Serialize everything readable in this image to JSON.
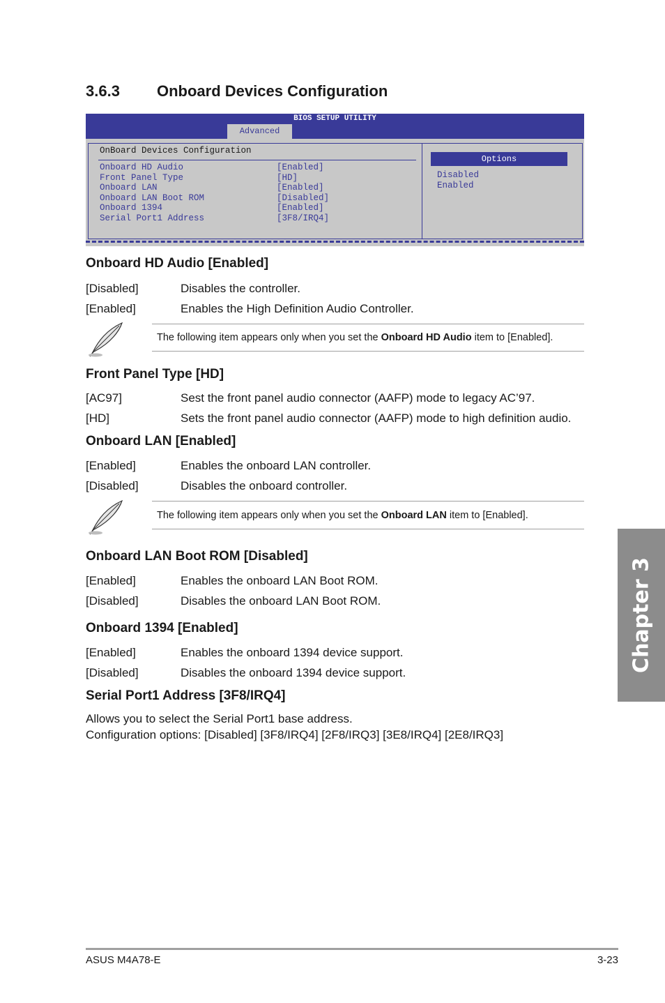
{
  "section": {
    "number": "3.6.3",
    "title": "Onboard Devices Configuration"
  },
  "bios": {
    "title": "BIOS SETUP UTILITY",
    "active_tab": "Advanced",
    "heading": "OnBoard Devices Configuration",
    "items": [
      {
        "label": "Onboard HD Audio",
        "value": "[Enabled]"
      },
      {
        "label": "Front Panel Type",
        "value": "[HD]"
      },
      {
        "label": "Onboard LAN",
        "value": "[Enabled]"
      },
      {
        "label": "Onboard LAN Boot ROM",
        "value": "[Disabled]"
      },
      {
        "label": "Onboard 1394",
        "value": "[Enabled]"
      },
      {
        "label": "Serial Port1 Address",
        "value": "[3F8/IRQ4]"
      }
    ],
    "options_header": "Options",
    "options": [
      "Disabled",
      "Enabled"
    ]
  },
  "items": [
    {
      "heading": "Onboard HD Audio [Enabled]",
      "rows": [
        {
          "k": "[Disabled]",
          "v": "Disables the controller."
        },
        {
          "k": "[Enabled]",
          "v": "Enables the High Definition Audio Controller."
        }
      ]
    },
    {
      "heading": "Front Panel Type [HD]",
      "rows": [
        {
          "k": "[AC97]",
          "v": "Sest the front panel audio connector (AAFP) mode to legacy AC’97."
        },
        {
          "k": "[HD]",
          "v": "Sets the front panel audio connector (AAFP) mode to high definition audio."
        }
      ]
    },
    {
      "heading": "Onboard LAN [Enabled]",
      "rows": [
        {
          "k": "[Enabled]",
          "v": "Enables the onboard LAN controller."
        },
        {
          "k": "[Disabled]",
          "v": "Disables the onboard controller."
        }
      ]
    },
    {
      "heading": "Onboard LAN Boot ROM [Disabled]",
      "rows": [
        {
          "k": "[Enabled]",
          "v": "Enables the onboard LAN Boot ROM."
        },
        {
          "k": "[Disabled]",
          "v": "Disables the onboard LAN Boot ROM."
        }
      ]
    },
    {
      "heading": "Onboard 1394 [Enabled]",
      "rows": [
        {
          "k": "[Enabled]",
          "v": "Enables the onboard 1394 device support."
        },
        {
          "k": "[Disabled]",
          "v": "Disables the onboard 1394 device support."
        }
      ]
    },
    {
      "heading": "Serial Port1 Address [3F8/IRQ4]",
      "lines": [
        "Allows you to select the Serial Port1 base address.",
        "Configuration options: [Disabled] [3F8/IRQ4] [2F8/IRQ3] [3E8/IRQ4] [2E8/IRQ3]"
      ]
    }
  ],
  "notes": [
    {
      "pre": "The following item appears only when you set the ",
      "bold": "Onboard HD Audio",
      "post": " item to [Enabled]."
    },
    {
      "pre": "The following item appears only when you set the ",
      "bold": "Onboard LAN",
      "post": " item to [Enabled]."
    }
  ],
  "chapter_tab": "Chapter 3",
  "footer": {
    "left": "ASUS M4A78-E",
    "right": "3-23"
  }
}
